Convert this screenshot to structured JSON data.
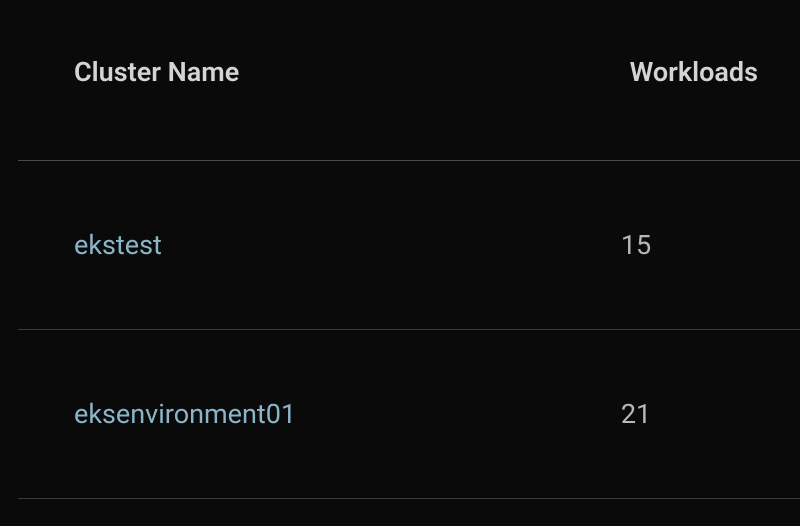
{
  "table": {
    "headers": {
      "cluster_name": "Cluster Name",
      "workloads": "Workloads"
    },
    "rows": [
      {
        "cluster_name": "ekstest",
        "workloads": "15"
      },
      {
        "cluster_name": "eksenvironment01",
        "workloads": "21"
      }
    ]
  }
}
